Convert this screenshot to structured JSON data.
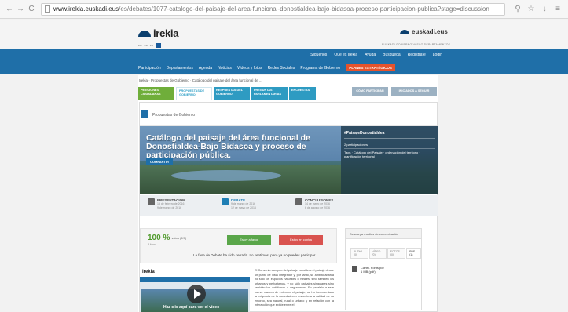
{
  "browser": {
    "back": "←",
    "forward": "→",
    "reload": "C",
    "url_domain": "www.irekia.euskadi.eus",
    "url_path": "/es/debates/1077-catalogo-del-paisaje-del-area-funcional-donostialdea-bajo-bidasoa-proceso-participacion-publica?stage=discussion",
    "icons": [
      "search-icon",
      "star-icon",
      "download-icon",
      "menu-icon"
    ]
  },
  "header": {
    "logo": "irekia",
    "languages": [
      "eu",
      "es",
      "en"
    ],
    "gov_logo": "euskadi.eus",
    "gov_links": "EUSKADI  GOBIERNO VASCO  DEPARTAMENTOS"
  },
  "nav": {
    "social": "Síguenos",
    "util": [
      "Qué es Irekia",
      "Ayuda",
      "Búsqueda",
      "Regístrate",
      "Login"
    ],
    "main": [
      "Participación",
      "Departamentos",
      "Agenda",
      "Noticias",
      "Vídeos y fotos",
      "Redes Sociales",
      "Programa de Gobierno"
    ],
    "plenary": "PLANES ESTRATÉGICOS"
  },
  "breadcrumb": "Irekia · Propuestas de Gobierno · Catálogo del paisaje del área funcional de ...",
  "tabs": [
    "PETICIONES CIUDADANAS",
    "PROPUESTAS DE GOBIERNO",
    "RESPUESTAS DEL GOBIERNO",
    "PREGUNTAS PARLAMENTARIAS",
    "ENCUESTAS"
  ],
  "action_buttons": [
    "CÓMO PARTICIPAR",
    "INICIADOS A SEGUIR"
  ],
  "section": {
    "title": "Propuestas de Gobierno"
  },
  "hero": {
    "title": "Catálogo del paisaje del área funcional de Donostialdea-Bajo Bidasoa y proceso de participación pública.",
    "share": "COMPARTIR",
    "hashtag": "#PaisajeDonostialdea",
    "participations": "2 participaciones",
    "tags": "Tags · Catálogo del Paisaje · ordenación del territorio · planificación territorial"
  },
  "phases": [
    {
      "label": "PRESENTACIÓN",
      "dates": "15 de febrero de 2016\n9 de marzo de 2016",
      "active": false
    },
    {
      "label": "DEBATE",
      "dates": "9 de marzo de 2016\n12 de mayo de 2016",
      "active": true
    },
    {
      "label": "CONCLUSIONES",
      "dates": "14 de mayo de 2016\n6 de agosto de 2016",
      "active": false
    }
  ],
  "votes": {
    "percent": "100 %",
    "count": "2 votos (2/0)",
    "favor": "A favor",
    "yes": "Estoy a favor",
    "no": "Estoy en contra",
    "closed": "La fase de Debate ha sido cerrada. Lo sentimos, pero ya no puedes participar."
  },
  "aside": {
    "title": "Descarga medios de comunicación",
    "tabs": [
      "AUDIO (0)",
      "VÍDEO (0)",
      "FOTOS (0)",
      "PDF (1)"
    ],
    "file": "Cartel. Fonts.pdf\n1 MB (pdf)"
  },
  "video": {
    "caption": "Haz clic aquí para ver el vídeo"
  },
  "body_text": "El Convenio europeo del paisaje considera el paisaje desde un punto de vista integrador y, por tanto, su ámbito abarca no sólo los espacios naturales o rurales, sino también los urbanos y periurbanos, y no sólo paisajes singulares sino también los cotidianos o degradados. En paralelo a este nuevo manera de entender el paisaje, se ha incrementado la exigencia de la sociedad con respecto a la calidad de su entorno, sea natural, rural o urbano y en relación con la interacción que existe entre el"
}
